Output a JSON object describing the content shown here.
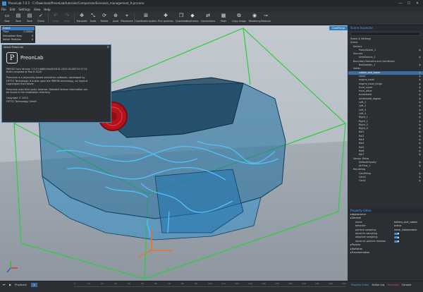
{
  "window": {
    "title": "PreonLab 7.0.5 - C:/Download/PreonLab/tutorials/Comparison/Scenes/e_management_9.prscene",
    "minimize": "—",
    "maximize": "☐",
    "close": "✕"
  },
  "menu": [
    "File",
    "Edit",
    "Settings",
    "View",
    "Help"
  ],
  "toolbar": [
    {
      "label": "New",
      "icon": "new-file-icon",
      "enabled": true
    },
    {
      "label": "Save",
      "icon": "save-icon",
      "enabled": true
    },
    {
      "label": "Save",
      "icon": "save-as-icon",
      "enabled": true
    },
    {
      "label": "Check",
      "icon": "check-icon",
      "enabled": true
    },
    {
      "label": "Undo",
      "icon": "undo-icon",
      "enabled": false
    },
    {
      "label": "Redo",
      "icon": "redo-icon",
      "enabled": false
    },
    {
      "label": "Translate",
      "icon": "translate-icon",
      "enabled": true
    },
    {
      "label": "Scale",
      "icon": "scale-icon",
      "enabled": true
    },
    {
      "label": "Rotate",
      "icon": "rotate-icon",
      "enabled": true
    },
    {
      "label": "Local",
      "icon": "local-icon",
      "enabled": true
    },
    {
      "label": "Placement",
      "icon": "placement-icon",
      "enabled": true
    },
    {
      "label": "Coordinate system",
      "icon": "coordinate-system-icon",
      "enabled": true
    },
    {
      "label": "Pick particles",
      "icon": "pick-particles-icon",
      "enabled": true
    },
    {
      "label": "Duplicate",
      "icon": "duplicate-icon",
      "enabled": true
    },
    {
      "label": "Keyframes",
      "icon": "keyframes-icon",
      "enabled": true
    },
    {
      "label": "Connections",
      "icon": "connections-icon",
      "enabled": true
    },
    {
      "label": "Plots",
      "icon": "plots-icon",
      "enabled": true
    },
    {
      "label": "Copy image",
      "icon": "copy-image-icon",
      "enabled": true
    },
    {
      "label": "Rendering",
      "icon": "rendering-icon",
      "enabled": true
    },
    {
      "label": "Measure",
      "icon": "measure-icon",
      "enabled": true
    }
  ],
  "scene_info": {
    "header": "Scene",
    "rows": [
      {
        "key": "Time",
        "value": "0.0000s"
      },
      {
        "key": "Simulation Step",
        "value": "0"
      },
      {
        "key": "Solver Particles",
        "value": "0"
      }
    ]
  },
  "about": {
    "title": "About PreonLab",
    "close": "✕",
    "logo_letter": "P",
    "product": "PreonLab",
    "version_line": "PREON Core Version 7.0.5+4d85c5dd010424 2025-03-06T10:17:22",
    "build_line": "Build compiled at Mar 6 2025",
    "para1": "PreonLab is a physically-based simulation software, developed by FIFTY2 Technology. It builds upon the PREON technology, an implicit Lagrangian fluid solver.",
    "para2": "PreonLab uses third party libraries. Detailed license information can be found in the installation directory.",
    "copyright": "Copyright © 2025",
    "company": "FIFTY2 Technology GmbH"
  },
  "viewport": {
    "camera_label": "CamPersp",
    "accent_green": "#2ecc40",
    "mesh_blue": "#2a8fd0"
  },
  "scene_inspector": {
    "title": "Scene Inspector",
    "items": [
      {
        "label": "Scene & Settings",
        "indent": 0
      },
      {
        "label": "Scene",
        "indent": 0
      },
      {
        "label": "Solvers",
        "indent": 1
      },
      {
        "label": "PreonSolver_1",
        "indent": 3
      },
      {
        "label": "Sources",
        "indent": 1
      },
      {
        "label": "AreaSource_1",
        "indent": 3
      },
      {
        "label": "Boundary Domains and Conditions",
        "indent": 1
      },
      {
        "label": "BoxDomain_1",
        "indent": 3
      },
      {
        "label": "Solids",
        "indent": 1
      },
      {
        "label": "cables_and_tubes",
        "indent": 3,
        "selected": true
      },
      {
        "label": "cover",
        "indent": 3
      },
      {
        "label": "engine_hood",
        "indent": 3
      },
      {
        "label": "engine_hood_hinge",
        "indent": 3
      },
      {
        "label": "front_cover",
        "indent": 3
      },
      {
        "label": "front_other",
        "indent": 3
      },
      {
        "label": "windshield",
        "indent": 3
      },
      {
        "label": "windshield_lagoon",
        "indent": 3
      },
      {
        "label": "Left_1",
        "indent": 3
      },
      {
        "label": "Left_2",
        "indent": 3
      },
      {
        "label": "Left_3",
        "indent": 3
      },
      {
        "label": "Left_4",
        "indent": 3
      },
      {
        "label": "Right_1",
        "indent": 3
      },
      {
        "label": "Right_2",
        "indent": 3
      },
      {
        "label": "Right_3",
        "indent": 3
      },
      {
        "label": "Right_4",
        "indent": 3
      },
      {
        "label": "Rel1",
        "indent": 3
      },
      {
        "label": "Rel2",
        "indent": 3
      },
      {
        "label": "Rel3",
        "indent": 3
      },
      {
        "label": "Rel4",
        "indent": 3
      },
      {
        "label": "Rel5",
        "indent": 3
      },
      {
        "label": "Rel6",
        "indent": 3
      },
      {
        "label": "Rel7",
        "indent": 3
      },
      {
        "label": "Sensor Fields",
        "indent": 1
      },
      {
        "label": "DefaultGravity",
        "indent": 3
      },
      {
        "label": "AirFlow_1",
        "indent": 3
      },
      {
        "label": "Rendering",
        "indent": 1
      },
      {
        "label": "CamPersp",
        "indent": 3
      },
      {
        "label": "Cam2",
        "indent": 3
      },
      {
        "label": "Cam1",
        "indent": 3
      }
    ]
  },
  "property_editor": {
    "title": "Property Editor",
    "sections": [
      {
        "label": "Appearance",
        "type": "header"
      },
      {
        "label": "General",
        "type": "header"
      },
      {
        "key": "name",
        "value": "battery_and_cables"
      },
      {
        "key": "behavior",
        "value": "active"
      },
      {
        "key": "particle sampling",
        "value": "mesh_independent"
      },
      {
        "key": "dynamic sampling",
        "value": "toggle"
      },
      {
        "key": "adaptive sampling",
        "value": "toggle"
      },
      {
        "key": "dynamic particle deletion",
        "value": "toggle"
      },
      {
        "label": "Physics",
        "type": "header"
      },
      {
        "label": "Statistics",
        "type": "header"
      },
      {
        "label": "Transformation",
        "type": "header"
      }
    ]
  },
  "timeline": {
    "play_label": "Playback",
    "frame": "1",
    "ticks": [
      "0",
      "10",
      "20",
      "30",
      "40",
      "50",
      "60",
      "70",
      "80",
      "90",
      "100",
      "110",
      "120",
      "130",
      "140",
      "150",
      "160",
      "170",
      "180",
      "190",
      "200"
    ]
  },
  "statusbar": {
    "left": "Property Editor",
    "action_log": "Action Log",
    "messages": "Messages",
    "console": "Console"
  }
}
